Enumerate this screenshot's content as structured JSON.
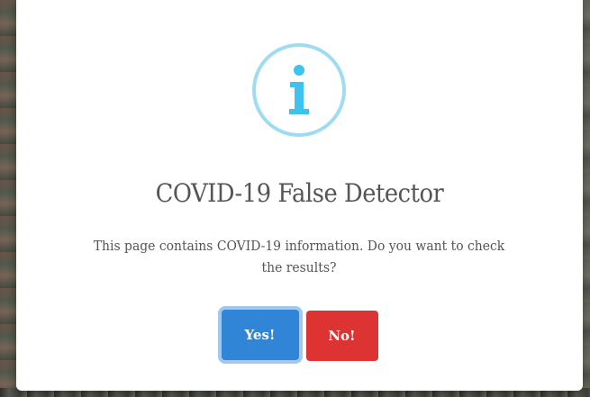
{
  "modal": {
    "icon": "info-icon",
    "title": "COVID-19 False Detector",
    "text": "This page contains COVID-19 information. Do you want to check the results?",
    "confirm_label": "Yes!",
    "cancel_label": "No!"
  },
  "colors": {
    "icon_border": "#9fdcf2",
    "icon_glyph": "#3fc3ee",
    "confirm": "#3085d6",
    "cancel": "#dd3333",
    "title": "#555555",
    "text": "#545454"
  }
}
